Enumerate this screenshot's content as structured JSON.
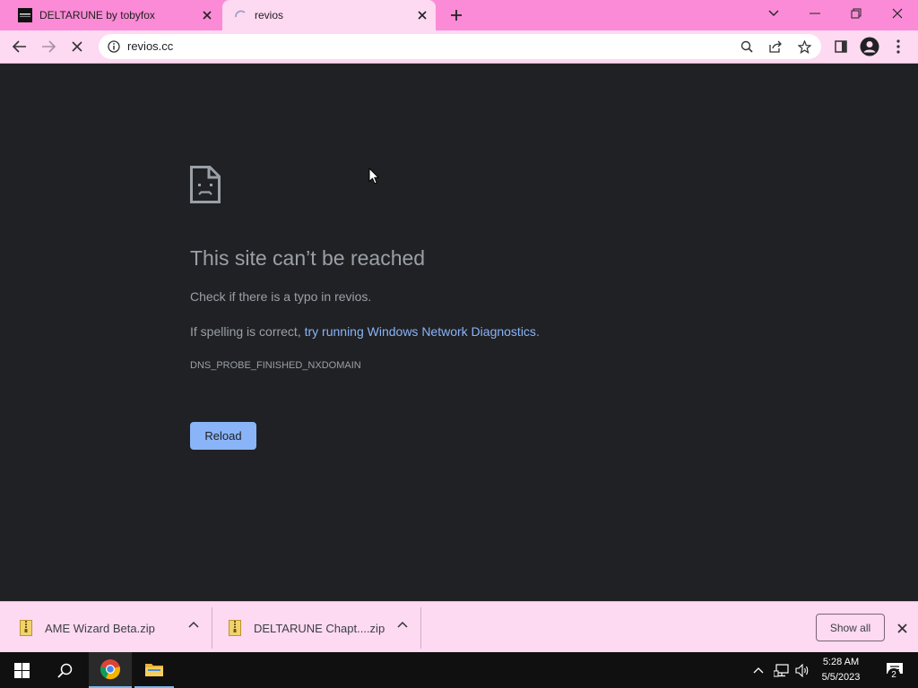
{
  "browser": {
    "tabs": [
      {
        "title": "DELTARUNE by tobyfox",
        "favicon": "deltarune-favicon",
        "active": false
      },
      {
        "title": "revios",
        "favicon": "loading-spinner-icon",
        "active": true
      }
    ],
    "address": "revios.cc",
    "accent": "#fb8bd6",
    "toolbar_bg": "#fdd9f2"
  },
  "error_page": {
    "title": "This site can’t be reached",
    "line1": "Check if there is a typo in revios.",
    "line2_prefix": "If spelling is correct, ",
    "line2_link": "try running Windows Network Diagnostics",
    "line2_suffix": ".",
    "code": "DNS_PROBE_FINISHED_NXDOMAIN",
    "reload_label": "Reload"
  },
  "downloads": {
    "items": [
      {
        "name": "AME Wizard Beta.zip"
      },
      {
        "name": "DELTARUNE Chapt....zip"
      }
    ],
    "show_all_label": "Show all"
  },
  "taskbar": {
    "time": "5:28 AM",
    "date": "5/5/2023",
    "notification_count": "2"
  }
}
